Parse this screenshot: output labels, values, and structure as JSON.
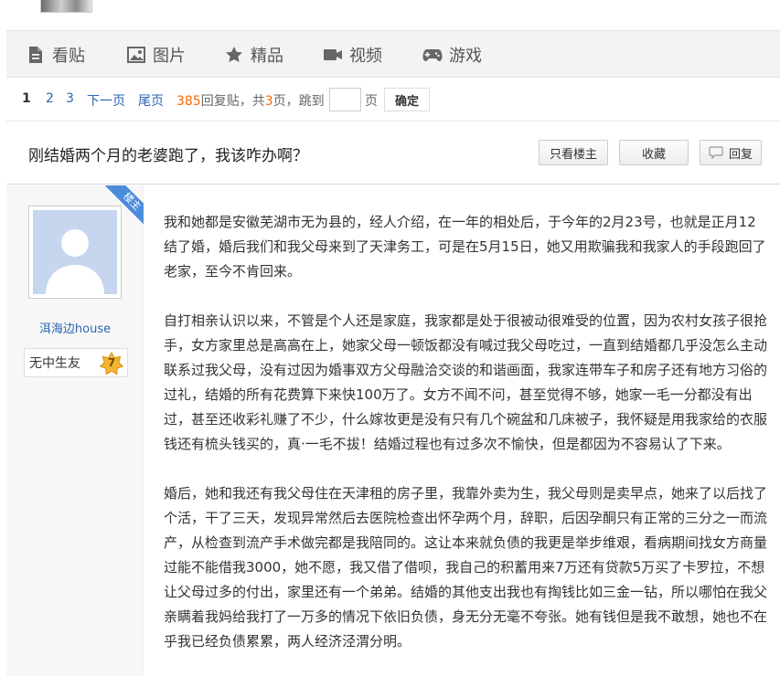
{
  "nav": {
    "items": [
      {
        "label": "看贴",
        "icon": "document-icon"
      },
      {
        "label": "图片",
        "icon": "image-icon"
      },
      {
        "label": "精品",
        "icon": "star-icon"
      },
      {
        "label": "视频",
        "icon": "video-camera-icon"
      },
      {
        "label": "游戏",
        "icon": "gamepad-icon"
      }
    ]
  },
  "pager": {
    "current": "1",
    "page2": "2",
    "page3": "3",
    "next": "下一页",
    "last": "尾页",
    "reply_count": "385",
    "reply_suffix": "回复贴，共",
    "total_pages": "3",
    "pages_jump": "页，跳到",
    "page_unit": "页",
    "confirm": "确定"
  },
  "thread": {
    "title": "刚结婚两个月的老婆跑了，我该咋办啊？",
    "only_op": "只看楼主",
    "favorite": "收藏",
    "reply": "回复"
  },
  "post": {
    "op_badge": "楼主",
    "username": "洱海边house",
    "level_name": "无中生友",
    "level_num": "7",
    "paragraphs": [
      "我和她都是安徽芜湖市无为县的，经人介绍，在一年的相处后，于今年的2月23号，也就是正月12结了婚，婚后我们和我父母来到了天津务工，可是在5月15日，她又用欺骗我和我家人的手段跑回了老家，至今不肯回来。",
      "自打相亲认识以来，不管是个人还是家庭，我家都是处于很被动很难受的位置，因为农村女孩子很抢手，女方家里总是高高在上，她家父母一顿饭都没有喊过我父母吃过，一直到结婚都几乎没怎么主动联系过我父母，没有过因为婚事双方父母融洽交谈的和谐画面，我家连带车子和房子还有地方习俗的过礼，结婚的所有花费算下来快100万了。女方不闻不问，甚至觉得不够，她家一毛一分都没有出过，甚至还收彩礼赚了不少，什么嫁妆更是没有只有几个碗盆和几床被子，我怀疑是用我家给的衣服钱还有梳头钱买的，真·一毛不拔！结婚过程也有过多次不愉快，但是都因为不容易认了下来。",
      "婚后，她和我还有我父母住在天津租的房子里，我靠外卖为生，我父母则是卖早点，她来了以后找了个活，干了三天，发现异常然后去医院检查出怀孕两个月，辞职，后因孕酮只有正常的三分之一而流产，从检查到流产手术做完都是我陪同的。这让本来就负债的我更是举步维艰，看病期间找女方商量过能不能借我3000，她不愿，我又借了借呗，我自己的积蓄用来7万还有贷款5万买了卡罗拉，不想让父母过多的付出，家里还有一个弟弟。结婚的其他支出我也有掏钱比如三金一钻，所以哪怕在我父亲瞒着我妈给我打了一万多的情况下依旧负债，身无分无毫不夸张。她有钱但是我不敢想，她也不在乎我已经负债累累，两人经济泾渭分明。"
    ]
  },
  "colors": {
    "link": "#2d64b3",
    "accent_orange": "#ff6600",
    "ribbon": "#4a8cdb",
    "nav_bg": "#f3f3f3"
  }
}
